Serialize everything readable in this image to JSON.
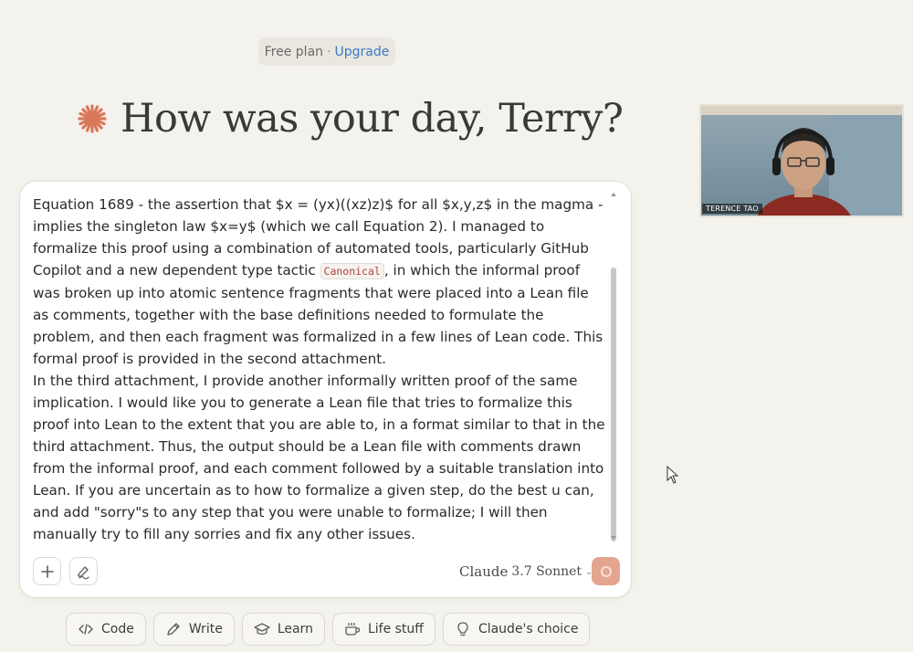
{
  "header": {
    "plan_label": "Free plan",
    "separator": "·",
    "upgrade_label": "Upgrade"
  },
  "greeting": "How was your day, Terry?",
  "video": {
    "name_tag": "TERENCE TAO"
  },
  "composer": {
    "paragraphs": [
      {
        "before_code": "Equation 1689 - the assertion that $x = (yx)((xz)z)$ for all $x,y,z$ in the magma - implies the singleton law $x=y$ (which we call Equation 2).  I managed to formalize this proof using a combination of automated tools, particularly GitHub Copilot and a new dependent type tactic ",
        "code": "Canonical",
        "after_code": ", in which the informal proof was broken up into atomic sentence fragments that were placed into a Lean file as comments, together with the base definitions needed to formulate the problem, and then each fragment was formalized in a few lines of Lean code.  This formal proof is provided in the second attachment."
      },
      {
        "text": "In the third attachment, I provide another informally written proof of the same implication.  I would like you to generate a Lean file that tries to formalize this proof into Lean to the extent that you are able to, in a format similar to that in the third attachment.  Thus, the output should be a Lean file with comments drawn from the informal proof, and each comment followed by a suitable translation into Lean. If you are uncertain as to how to formalize a given step, do the best u can, and add \"sorry\"s to any step that you were unable to formalize; I will then manually try to fill any sorries and fix any other issues."
      }
    ],
    "model_name": "Claude",
    "model_version": "3.7 Sonnet",
    "add_icon": "plus-icon",
    "style_icon": "pen-scribble-icon",
    "send_icon": "send-loading-icon"
  },
  "chips": [
    {
      "label": "Code",
      "icon": "code-icon"
    },
    {
      "label": "Write",
      "icon": "pencil-icon"
    },
    {
      "label": "Learn",
      "icon": "graduation-cap-icon"
    },
    {
      "label": "Life stuff",
      "icon": "coffee-cup-icon"
    },
    {
      "label": "Claude's choice",
      "icon": "lightbulb-icon"
    }
  ],
  "colors": {
    "background": "#f3f2ed",
    "accent": "#d97757",
    "link": "#3b78c7",
    "send_button": "#e3a58f"
  }
}
